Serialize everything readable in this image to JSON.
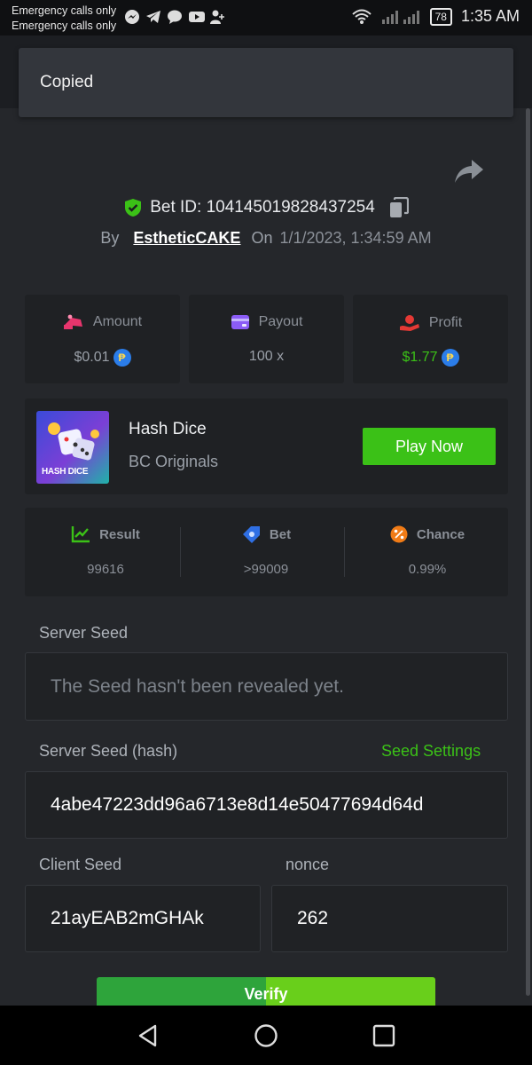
{
  "status_bar": {
    "carrier_line1": "Emergency calls only",
    "carrier_line2": "Emergency calls only",
    "battery": "78",
    "time": "1:35 AM",
    "notification_icons": [
      "messenger-icon",
      "telegram-icon",
      "chat-icon",
      "youtube-icon",
      "add-user-icon"
    ]
  },
  "toast": {
    "text": "Copied"
  },
  "bet": {
    "id_label": "Bet ID: 104145019828437254",
    "by_label": "By",
    "username": "EstheticCAKE",
    "on_label": "On",
    "date": "1/1/2023, 1:34:59 AM"
  },
  "stats": {
    "amount": {
      "label": "Amount",
      "value": "$0.01"
    },
    "payout": {
      "label": "Payout",
      "value": "100 x"
    },
    "profit": {
      "label": "Profit",
      "value": "$1.77"
    }
  },
  "game": {
    "thumb_text": "HASH DICE",
    "name": "Hash Dice",
    "provider": "BC Originals",
    "play_label": "Play Now"
  },
  "results": {
    "result": {
      "label": "Result",
      "value": "99616"
    },
    "bet": {
      "label": "Bet",
      "value": ">99009"
    },
    "chance": {
      "label": "Chance",
      "value": "0.99%"
    }
  },
  "seeds": {
    "server_seed_label": "Server Seed",
    "server_seed_value": "The Seed hasn't been revealed yet.",
    "server_hash_label": "Server Seed (hash)",
    "seed_settings_label": "Seed Settings",
    "server_hash_value": "4abe47223dd96a6713e8d14e50477694d64d",
    "client_seed_label": "Client Seed",
    "client_seed_value": "21ayEAB2mGHAk",
    "nonce_label": "nonce",
    "nonce_value": "262"
  },
  "verify": {
    "label": "Verify"
  },
  "colors": {
    "accent_green": "#3bc117",
    "background": "#25272b",
    "card": "#1f2124"
  }
}
